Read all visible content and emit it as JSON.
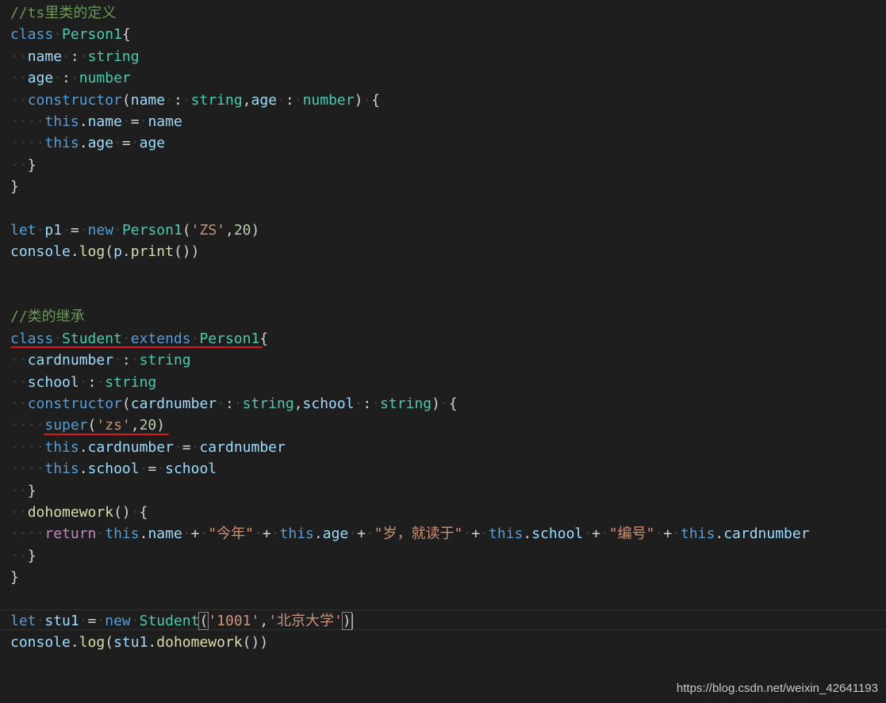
{
  "editor": {
    "lines": [
      [
        {
          "cls": "c",
          "text": "//ts里类的定义"
        }
      ],
      [
        {
          "cls": "k",
          "text": "class"
        },
        {
          "cls": "sp",
          "text": "·"
        },
        {
          "cls": "t",
          "text": "Person1"
        },
        {
          "cls": "p",
          "text": "{"
        }
      ],
      [
        {
          "cls": "sp",
          "text": "··"
        },
        {
          "cls": "v",
          "text": "name"
        },
        {
          "cls": "sp",
          "text": "·"
        },
        {
          "cls": "p",
          "text": ":"
        },
        {
          "cls": "sp",
          "text": "·"
        },
        {
          "cls": "t",
          "text": "string"
        }
      ],
      [
        {
          "cls": "sp",
          "text": "··"
        },
        {
          "cls": "v",
          "text": "age"
        },
        {
          "cls": "sp",
          "text": "·"
        },
        {
          "cls": "p",
          "text": ":"
        },
        {
          "cls": "sp",
          "text": "·"
        },
        {
          "cls": "t",
          "text": "number"
        }
      ],
      [
        {
          "cls": "sp",
          "text": "··"
        },
        {
          "cls": "k",
          "text": "constructor"
        },
        {
          "cls": "p",
          "text": "("
        },
        {
          "cls": "v",
          "text": "name"
        },
        {
          "cls": "sp",
          "text": "·"
        },
        {
          "cls": "p",
          "text": ":"
        },
        {
          "cls": "sp",
          "text": "·"
        },
        {
          "cls": "t",
          "text": "string"
        },
        {
          "cls": "p",
          "text": ","
        },
        {
          "cls": "v",
          "text": "age"
        },
        {
          "cls": "sp",
          "text": "·"
        },
        {
          "cls": "p",
          "text": ":"
        },
        {
          "cls": "sp",
          "text": "·"
        },
        {
          "cls": "t",
          "text": "number"
        },
        {
          "cls": "p",
          "text": ")"
        },
        {
          "cls": "sp",
          "text": "·"
        },
        {
          "cls": "p",
          "text": "{"
        }
      ],
      [
        {
          "cls": "sp",
          "text": "····"
        },
        {
          "cls": "k",
          "text": "this"
        },
        {
          "cls": "p",
          "text": "."
        },
        {
          "cls": "v",
          "text": "name"
        },
        {
          "cls": "sp",
          "text": "·"
        },
        {
          "cls": "p",
          "text": "="
        },
        {
          "cls": "sp",
          "text": "·"
        },
        {
          "cls": "v",
          "text": "name"
        }
      ],
      [
        {
          "cls": "sp",
          "text": "····"
        },
        {
          "cls": "k",
          "text": "this"
        },
        {
          "cls": "p",
          "text": "."
        },
        {
          "cls": "v",
          "text": "age"
        },
        {
          "cls": "sp",
          "text": "·"
        },
        {
          "cls": "p",
          "text": "="
        },
        {
          "cls": "sp",
          "text": "·"
        },
        {
          "cls": "v",
          "text": "age"
        }
      ],
      [
        {
          "cls": "sp",
          "text": "··"
        },
        {
          "cls": "p",
          "text": "}"
        }
      ],
      [
        {
          "cls": "p",
          "text": "}"
        }
      ],
      [],
      [
        {
          "cls": "k",
          "text": "let"
        },
        {
          "cls": "sp",
          "text": "·"
        },
        {
          "cls": "v",
          "text": "p1"
        },
        {
          "cls": "sp",
          "text": "·"
        },
        {
          "cls": "p",
          "text": "="
        },
        {
          "cls": "sp",
          "text": "·"
        },
        {
          "cls": "k",
          "text": "new"
        },
        {
          "cls": "sp",
          "text": "·"
        },
        {
          "cls": "t",
          "text": "Person1"
        },
        {
          "cls": "p",
          "text": "("
        },
        {
          "cls": "s",
          "text": "'ZS'"
        },
        {
          "cls": "p",
          "text": ","
        },
        {
          "cls": "n",
          "text": "20"
        },
        {
          "cls": "p",
          "text": ")"
        }
      ],
      [
        {
          "cls": "v",
          "text": "console"
        },
        {
          "cls": "p",
          "text": "."
        },
        {
          "cls": "f",
          "text": "log"
        },
        {
          "cls": "p",
          "text": "("
        },
        {
          "cls": "v",
          "text": "p"
        },
        {
          "cls": "p",
          "text": "."
        },
        {
          "cls": "f",
          "text": "print"
        },
        {
          "cls": "p",
          "text": "())"
        }
      ],
      [],
      [],
      [
        {
          "cls": "c",
          "text": "//类的继承"
        }
      ],
      [
        {
          "cls": "k",
          "text": "class"
        },
        {
          "cls": "sp",
          "text": "·"
        },
        {
          "cls": "t",
          "text": "Student"
        },
        {
          "cls": "sp",
          "text": "·"
        },
        {
          "cls": "k",
          "text": "extends"
        },
        {
          "cls": "sp",
          "text": "·"
        },
        {
          "cls": "t",
          "text": "Person1"
        },
        {
          "cls": "p",
          "text": "{"
        }
      ],
      [
        {
          "cls": "sp",
          "text": "··"
        },
        {
          "cls": "v",
          "text": "cardnumber"
        },
        {
          "cls": "sp",
          "text": "·"
        },
        {
          "cls": "p",
          "text": ":"
        },
        {
          "cls": "sp",
          "text": "·"
        },
        {
          "cls": "t",
          "text": "string"
        }
      ],
      [
        {
          "cls": "sp",
          "text": "··"
        },
        {
          "cls": "v",
          "text": "school"
        },
        {
          "cls": "sp",
          "text": "·"
        },
        {
          "cls": "p",
          "text": ":"
        },
        {
          "cls": "sp",
          "text": "·"
        },
        {
          "cls": "t",
          "text": "string"
        }
      ],
      [
        {
          "cls": "sp",
          "text": "··"
        },
        {
          "cls": "k",
          "text": "constructor"
        },
        {
          "cls": "p",
          "text": "("
        },
        {
          "cls": "v",
          "text": "cardnumber"
        },
        {
          "cls": "sp",
          "text": "·"
        },
        {
          "cls": "p",
          "text": ":"
        },
        {
          "cls": "sp",
          "text": "·"
        },
        {
          "cls": "t",
          "text": "string"
        },
        {
          "cls": "p",
          "text": ","
        },
        {
          "cls": "v",
          "text": "school"
        },
        {
          "cls": "sp",
          "text": "·"
        },
        {
          "cls": "p",
          "text": ":"
        },
        {
          "cls": "sp",
          "text": "·"
        },
        {
          "cls": "t",
          "text": "string"
        },
        {
          "cls": "p",
          "text": ")"
        },
        {
          "cls": "sp",
          "text": "·"
        },
        {
          "cls": "p",
          "text": "{"
        }
      ],
      [
        {
          "cls": "sp",
          "text": "····"
        },
        {
          "cls": "k",
          "text": "super"
        },
        {
          "cls": "p",
          "text": "("
        },
        {
          "cls": "s",
          "text": "'zs'"
        },
        {
          "cls": "p",
          "text": ","
        },
        {
          "cls": "n",
          "text": "20"
        },
        {
          "cls": "p",
          "text": ")"
        }
      ],
      [
        {
          "cls": "sp",
          "text": "····"
        },
        {
          "cls": "k",
          "text": "this"
        },
        {
          "cls": "p",
          "text": "."
        },
        {
          "cls": "v",
          "text": "cardnumber"
        },
        {
          "cls": "sp",
          "text": "·"
        },
        {
          "cls": "p",
          "text": "="
        },
        {
          "cls": "sp",
          "text": "·"
        },
        {
          "cls": "v",
          "text": "cardnumber"
        }
      ],
      [
        {
          "cls": "sp",
          "text": "····"
        },
        {
          "cls": "k",
          "text": "this"
        },
        {
          "cls": "p",
          "text": "."
        },
        {
          "cls": "v",
          "text": "school"
        },
        {
          "cls": "sp",
          "text": "·"
        },
        {
          "cls": "p",
          "text": "="
        },
        {
          "cls": "sp",
          "text": "·"
        },
        {
          "cls": "v",
          "text": "school"
        }
      ],
      [
        {
          "cls": "sp",
          "text": "··"
        },
        {
          "cls": "p",
          "text": "}"
        }
      ],
      [
        {
          "cls": "sp",
          "text": "··"
        },
        {
          "cls": "f",
          "text": "dohomework"
        },
        {
          "cls": "p",
          "text": "()"
        },
        {
          "cls": "sp",
          "text": "·"
        },
        {
          "cls": "p",
          "text": "{"
        }
      ],
      [
        {
          "cls": "sp",
          "text": "····"
        },
        {
          "cls": "ctl",
          "text": "return"
        },
        {
          "cls": "sp",
          "text": "·"
        },
        {
          "cls": "k",
          "text": "this"
        },
        {
          "cls": "p",
          "text": "."
        },
        {
          "cls": "v",
          "text": "name"
        },
        {
          "cls": "sp",
          "text": "·"
        },
        {
          "cls": "p",
          "text": "+"
        },
        {
          "cls": "sp",
          "text": "·"
        },
        {
          "cls": "s",
          "text": "\"今年\""
        },
        {
          "cls": "sp",
          "text": "·"
        },
        {
          "cls": "p",
          "text": "+"
        },
        {
          "cls": "sp",
          "text": "·"
        },
        {
          "cls": "k",
          "text": "this"
        },
        {
          "cls": "p",
          "text": "."
        },
        {
          "cls": "v",
          "text": "age"
        },
        {
          "cls": "sp",
          "text": "·"
        },
        {
          "cls": "p",
          "text": "+"
        },
        {
          "cls": "sp",
          "text": "·"
        },
        {
          "cls": "s",
          "text": "\"岁，就读于\""
        },
        {
          "cls": "sp",
          "text": "·"
        },
        {
          "cls": "p",
          "text": "+"
        },
        {
          "cls": "sp",
          "text": "·"
        },
        {
          "cls": "k",
          "text": "this"
        },
        {
          "cls": "p",
          "text": "."
        },
        {
          "cls": "v",
          "text": "school"
        },
        {
          "cls": "sp",
          "text": "·"
        },
        {
          "cls": "p",
          "text": "+"
        },
        {
          "cls": "sp",
          "text": "·"
        },
        {
          "cls": "s",
          "text": "\"编号\""
        },
        {
          "cls": "sp",
          "text": "·"
        },
        {
          "cls": "p",
          "text": "+"
        },
        {
          "cls": "sp",
          "text": "·"
        },
        {
          "cls": "k",
          "text": "this"
        },
        {
          "cls": "p",
          "text": "."
        },
        {
          "cls": "v",
          "text": "cardnumber"
        }
      ],
      [
        {
          "cls": "sp",
          "text": "··"
        },
        {
          "cls": "p",
          "text": "}"
        }
      ],
      [
        {
          "cls": "p",
          "text": "}"
        }
      ],
      [],
      [
        {
          "cls": "k",
          "text": "let"
        },
        {
          "cls": "sp",
          "text": "·"
        },
        {
          "cls": "v",
          "text": "stu1"
        },
        {
          "cls": "sp",
          "text": "·"
        },
        {
          "cls": "p",
          "text": "="
        },
        {
          "cls": "sp",
          "text": "·"
        },
        {
          "cls": "k",
          "text": "new"
        },
        {
          "cls": "sp",
          "text": "·"
        },
        {
          "cls": "t",
          "text": "Student"
        },
        {
          "cls": "p bracket-match",
          "text": "("
        },
        {
          "cls": "s",
          "text": "'1001'"
        },
        {
          "cls": "p",
          "text": ","
        },
        {
          "cls": "s",
          "text": "'北京大学'"
        },
        {
          "cls": "p bracket-match",
          "text": ")"
        },
        {
          "cls": "cursor",
          "text": ""
        }
      ],
      [
        {
          "cls": "v",
          "text": "console"
        },
        {
          "cls": "p",
          "text": "."
        },
        {
          "cls": "f",
          "text": "log"
        },
        {
          "cls": "p",
          "text": "("
        },
        {
          "cls": "v",
          "text": "stu1"
        },
        {
          "cls": "p",
          "text": "."
        },
        {
          "cls": "f",
          "text": "dohomework"
        },
        {
          "cls": "p",
          "text": "())"
        }
      ]
    ]
  },
  "watermark": {
    "text": "https://blog.csdn.net/weixin_42641193"
  },
  "colors": {
    "background": "#1e1e1e",
    "keyword": "#569cd6",
    "control": "#c586c0",
    "type": "#4ec9b0",
    "variable": "#9cdcfe",
    "function": "#dcdcaa",
    "string": "#ce9178",
    "number": "#b5cea8",
    "comment": "#6a9955",
    "annotation_underline": "#e0141b"
  }
}
